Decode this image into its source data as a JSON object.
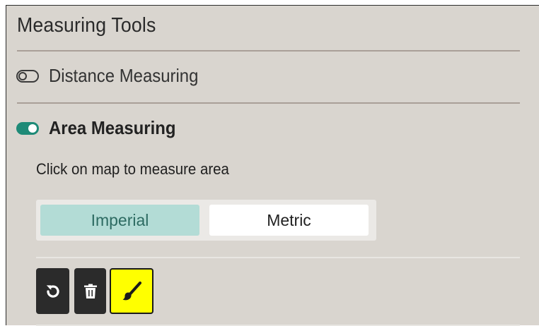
{
  "panel": {
    "title": "Measuring Tools"
  },
  "tools": [
    {
      "label": "Distance Measuring",
      "enabled": false
    },
    {
      "label": "Area Measuring",
      "enabled": true
    }
  ],
  "area": {
    "hint": "Click on map to measure area",
    "units": {
      "options": [
        "Imperial",
        "Metric"
      ],
      "selected": "Imperial"
    },
    "actions": [
      {
        "name": "undo",
        "icon": "undo-icon"
      },
      {
        "name": "clear",
        "icon": "trash-icon"
      },
      {
        "name": "style",
        "icon": "paintbrush-icon",
        "active": true
      }
    ]
  },
  "colors": {
    "panel_bg": "#d9d5cf",
    "toggle_on": "#1e8a77",
    "selected_unit_bg": "#b3dcd6",
    "active_tool_bg": "#ffff00",
    "tool_bg": "#2b2b2b"
  }
}
